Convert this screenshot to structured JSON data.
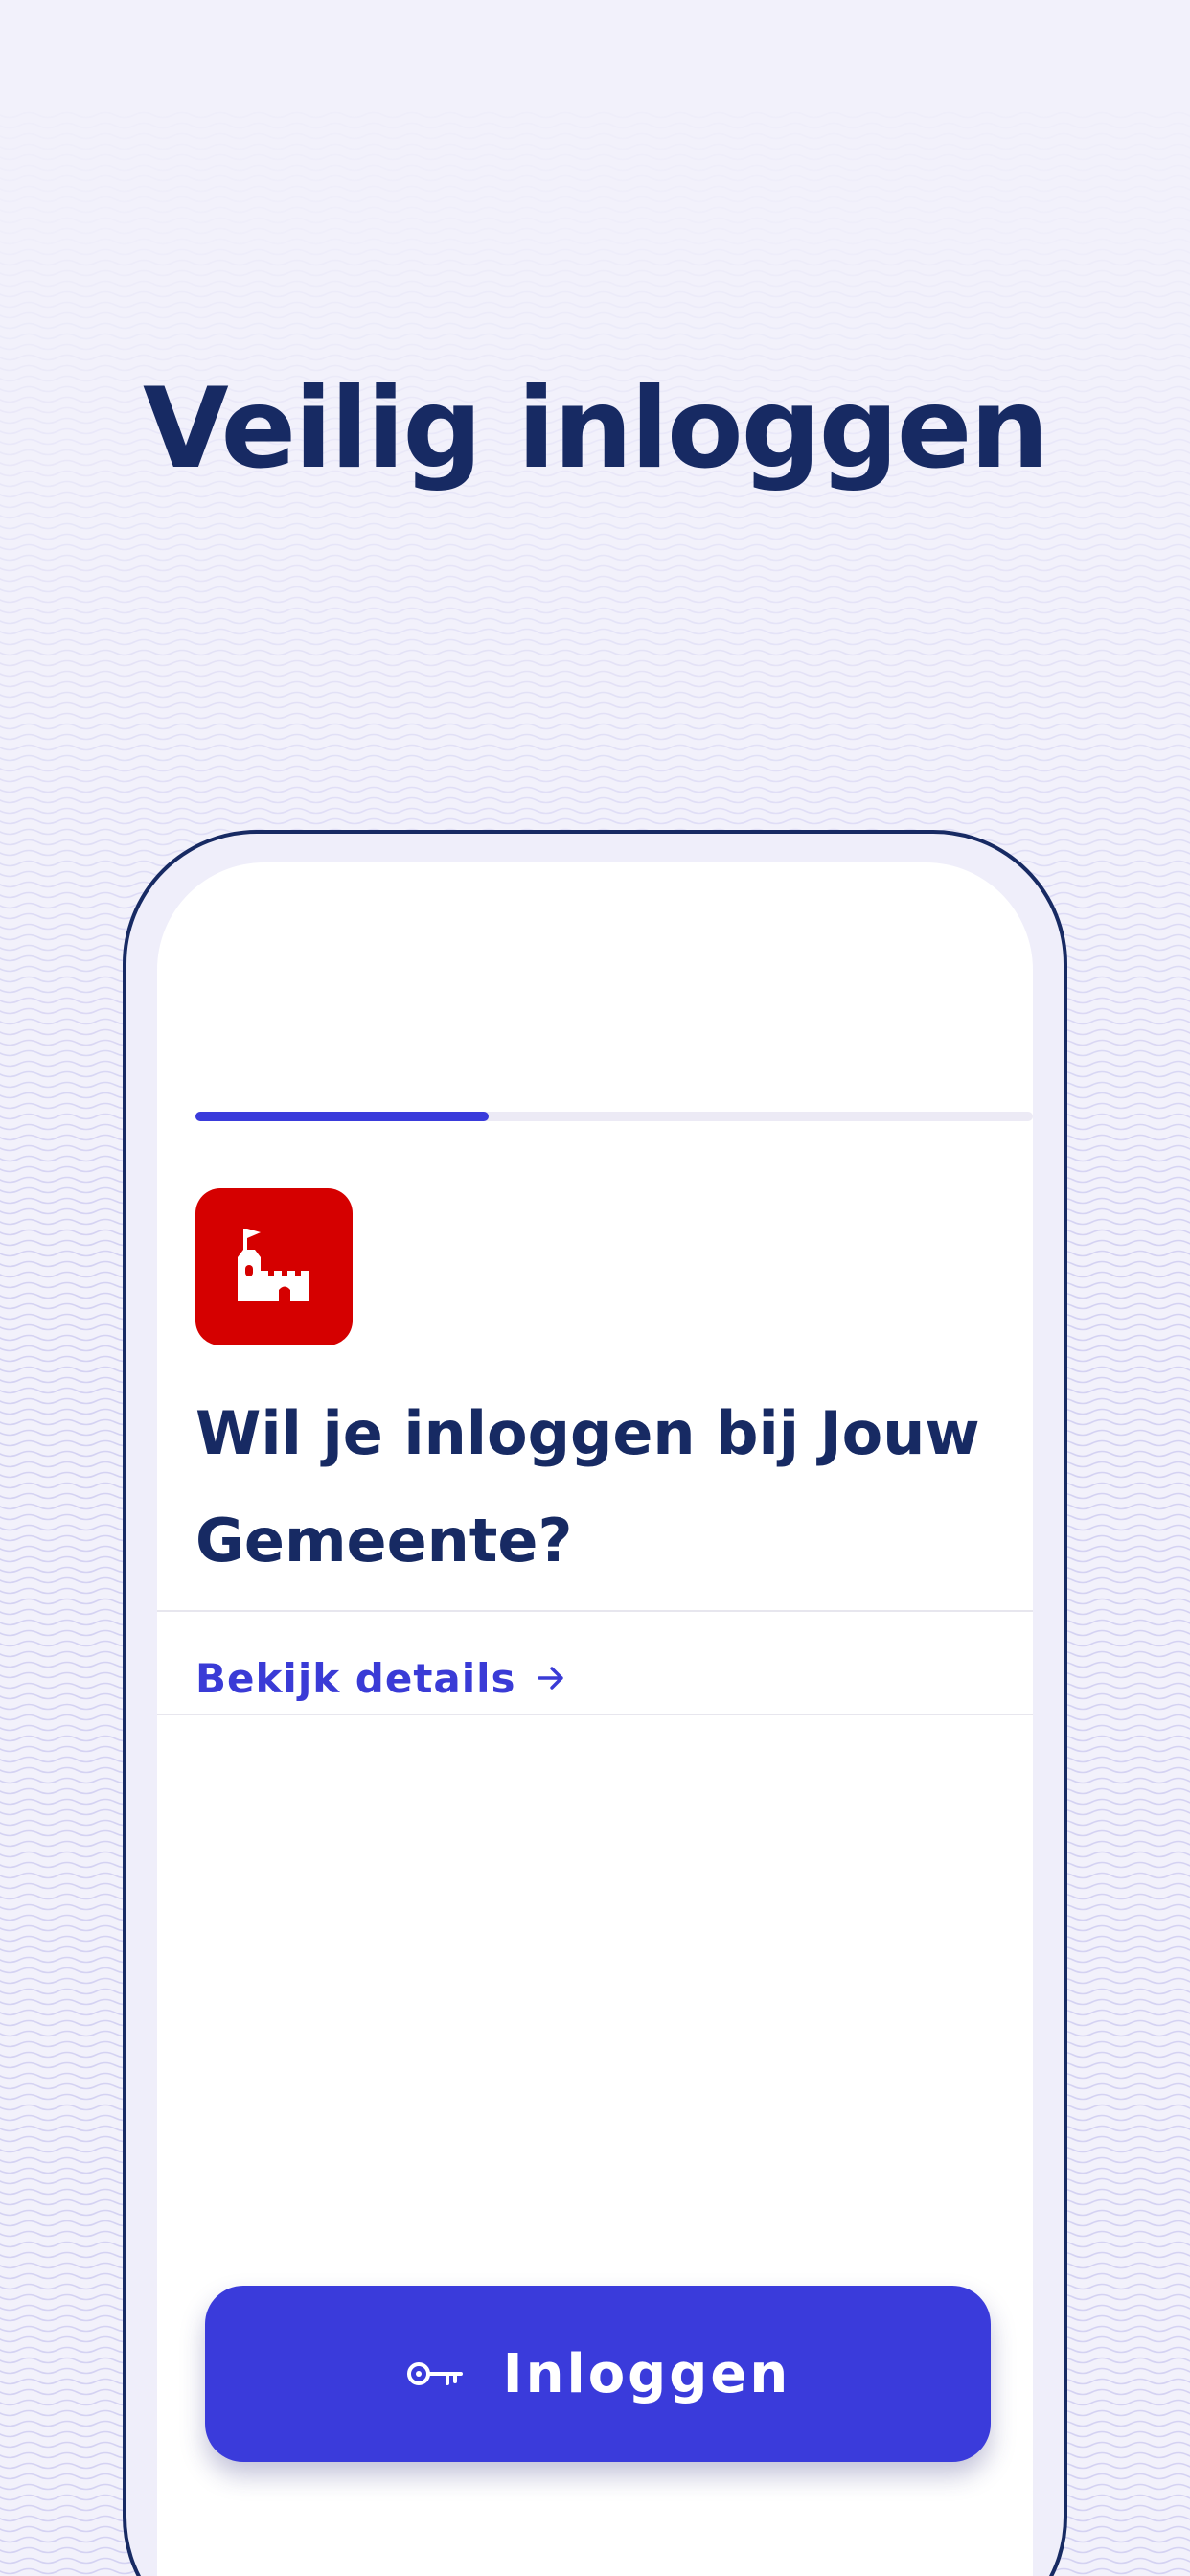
{
  "headline": "Veilig inloggen",
  "progress": {
    "fraction": 0.35,
    "color": "#3a3bdb"
  },
  "app": {
    "logo_icon": "castle-icon",
    "logo_color": "#d50000"
  },
  "question": "Wil je inloggen bij Jouw Gemeente?",
  "details_link": {
    "label": "Bekijk details",
    "icon": "arrow-right-icon"
  },
  "login_button": {
    "label": "Inloggen",
    "icon": "key-icon",
    "color": "#3a3bdb"
  },
  "colors": {
    "navy": "#172a63",
    "accent": "#3a3bdb",
    "background": "#f2f1fb"
  }
}
